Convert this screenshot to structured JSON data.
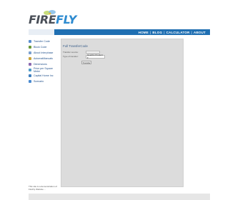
{
  "header": {
    "logo_text_a": "FIRE",
    "logo_text_b": "FLY",
    "nav": [
      "HOME",
      "BLOG",
      "CALCULATOR",
      "ABOUT"
    ],
    "nav_separator": "|"
  },
  "sidebar": {
    "items": [
      {
        "label": "Transfer Code",
        "icon": "folder-icon",
        "color": "#5a8fd0"
      },
      {
        "label": "Block Code",
        "icon": "block-icon",
        "color": "#6a9a3a"
      },
      {
        "label": "About Interphase",
        "icon": "info-icon",
        "color": "#7aa0cf"
      },
      {
        "label": "AutomatManuals",
        "icon": "manual-icon",
        "color": "#c9a53a"
      },
      {
        "label": "Dimensions",
        "icon": "ruler-icon",
        "color": "#8b6ab0"
      },
      {
        "label": "Price per Square Meter",
        "icon": "price-icon",
        "color": "#4f9cc9"
      },
      {
        "label": "Capital Home Inc",
        "icon": "home-icon",
        "color": "#3f7fbf"
      },
      {
        "label": "Scenario",
        "icon": "scenario-icon",
        "color": "#4a8ad0"
      }
    ]
  },
  "form": {
    "title": "Full TransferCode",
    "field1_label": "Transfer source:",
    "field1_value": "",
    "field2_label": "Type of transfer:",
    "field2_value": "Heartbs Product ▾",
    "submit_label": "Transfer"
  },
  "footer": {
    "note": "This site is a demonstration of FireFly Website ...",
    "colors": {
      "nav": "#1f6fb2",
      "content_bg": "#dcdcdc"
    }
  }
}
